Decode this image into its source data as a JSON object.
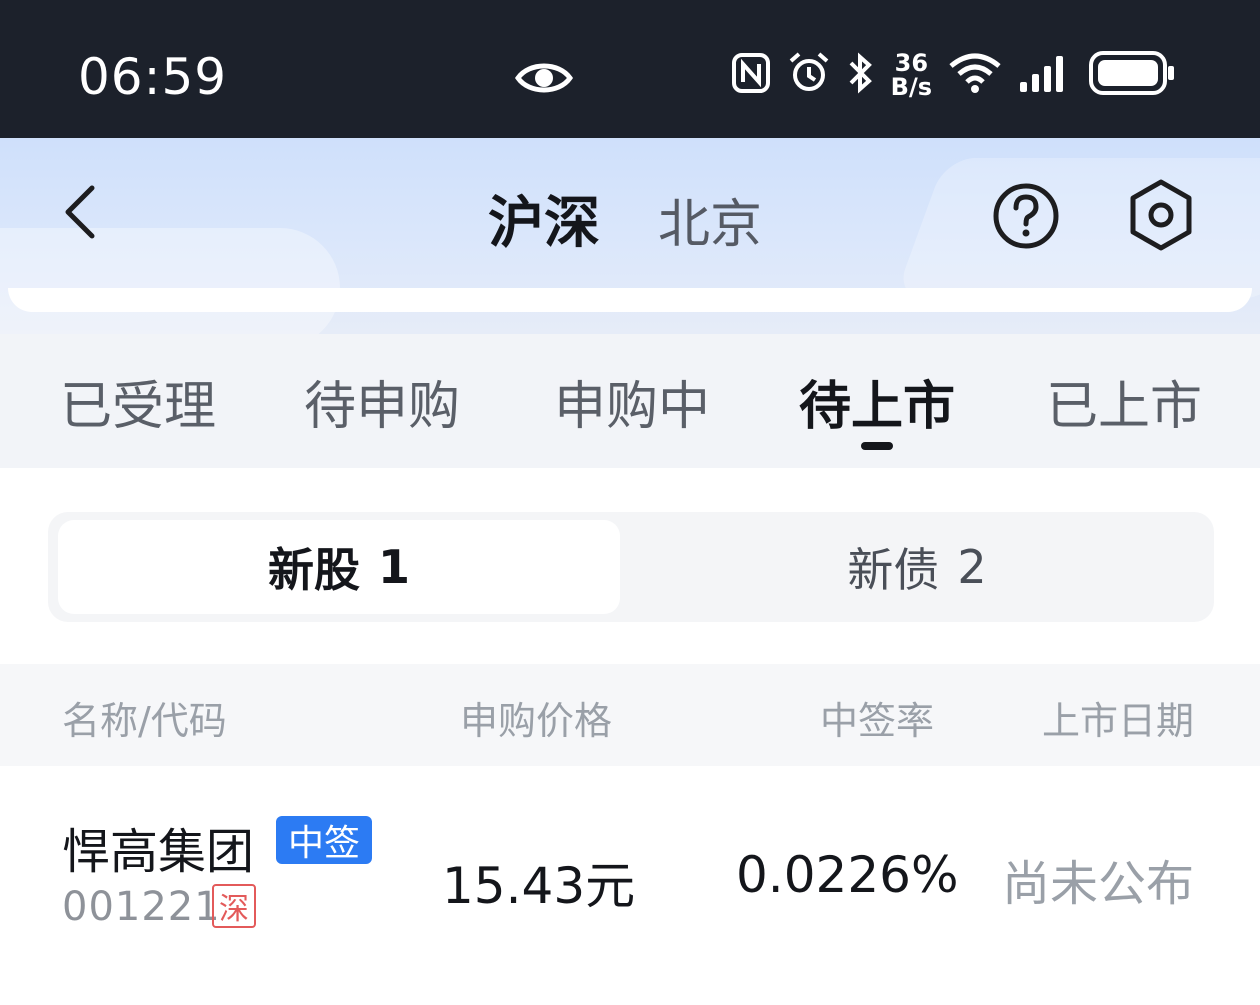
{
  "status_bar": {
    "time": "06:59",
    "net_speed_value": "36",
    "net_speed_unit": "B/s",
    "icons": [
      "eye-icon",
      "nfc-icon",
      "alarm-icon",
      "bluetooth-icon",
      "wifi-icon",
      "signal-icon",
      "battery-icon"
    ]
  },
  "header": {
    "back_icon": "chevron-left-icon",
    "market_tabs": [
      {
        "label": "沪深",
        "active": true
      },
      {
        "label": "北京",
        "active": false
      }
    ],
    "help_icon": "help-circle-icon",
    "settings_icon": "hexagon-settings-icon"
  },
  "status_tabs": [
    {
      "label": "已受理",
      "active": false
    },
    {
      "label": "待申购",
      "active": false
    },
    {
      "label": "申购中",
      "active": false
    },
    {
      "label": "待上市",
      "active": true
    },
    {
      "label": "已上市",
      "active": false
    }
  ],
  "segment": {
    "items": [
      {
        "label": "新股",
        "count": "1",
        "active": true
      },
      {
        "label": "新债",
        "count": "2",
        "active": false
      }
    ]
  },
  "table": {
    "headers": [
      "名称/代码",
      "申购价格",
      "中签率",
      "上市日期"
    ],
    "rows": [
      {
        "name": "悍高集团",
        "badge": "中签",
        "code": "001221",
        "market": "深",
        "price": "15.43元",
        "rate": "0.0226%",
        "listing_date": "尚未公布"
      }
    ]
  },
  "colors": {
    "status_bar_bg": "#1c212b",
    "accent_blue": "#2c7bf3",
    "market_red": "#e35a5a"
  }
}
